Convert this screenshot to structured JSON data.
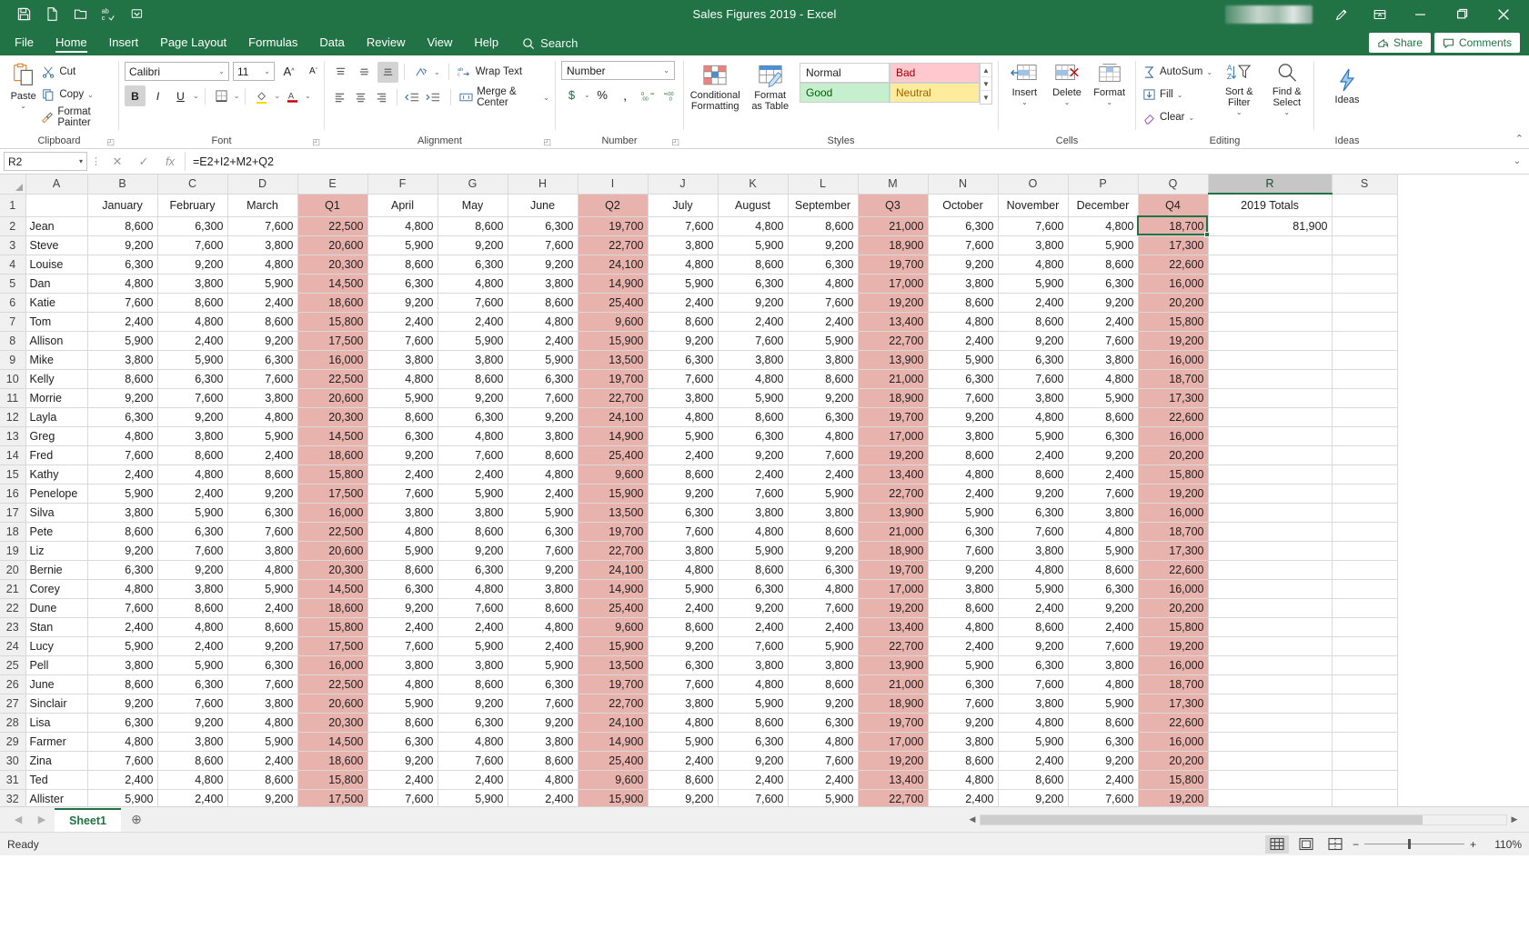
{
  "window": {
    "title": "Sales Figures 2019  -  Excel",
    "quick_access": [
      "save-icon",
      "new-icon",
      "open-icon",
      "spelling-icon",
      "customize-qat-icon"
    ],
    "controls": [
      "pen-icon",
      "ribbon-display-icon",
      "minimize-icon",
      "restore-icon",
      "close-icon"
    ]
  },
  "tabs": {
    "items": [
      "File",
      "Home",
      "Insert",
      "Page Layout",
      "Formulas",
      "Data",
      "Review",
      "View",
      "Help"
    ],
    "active": "Home",
    "search_placeholder": "Search",
    "share_label": "Share",
    "comments_label": "Comments"
  },
  "ribbon": {
    "clipboard": {
      "label": "Clipboard",
      "paste": "Paste",
      "cut": "Cut",
      "copy": "Copy",
      "format_painter": "Format Painter"
    },
    "font": {
      "label": "Font",
      "font_name": "Calibri",
      "font_size": "11",
      "grow_label": "A",
      "shrink_label": "A",
      "bold": "B",
      "italic": "I",
      "underline": "U"
    },
    "alignment": {
      "label": "Alignment",
      "wrap_text": "Wrap Text",
      "merge_center": "Merge & Center"
    },
    "number": {
      "label": "Number",
      "format": "Number",
      "currency": "$",
      "percent": "%",
      "comma": ","
    },
    "styles": {
      "label": "Styles",
      "conditional_formatting": "Conditional Formatting",
      "format_as_table": "Format as Table",
      "cell_styles": [
        "Normal",
        "Bad",
        "Good",
        "Neutral"
      ]
    },
    "cells": {
      "label": "Cells",
      "insert": "Insert",
      "delete": "Delete",
      "format": "Format"
    },
    "editing": {
      "label": "Editing",
      "autosum": "AutoSum",
      "fill": "Fill",
      "clear": "Clear",
      "sort_filter": "Sort & Filter",
      "find_select": "Find & Select"
    },
    "ideas": {
      "label": "Ideas",
      "button": "Ideas"
    }
  },
  "formula_bar": {
    "name_box": "R2",
    "formula": "=E2+I2+M2+Q2",
    "cancel_icon": "cancel-icon",
    "enter_icon": "enter-icon",
    "function_icon": "insert-function-icon"
  },
  "sheet": {
    "column_letters": [
      "A",
      "B",
      "C",
      "D",
      "E",
      "F",
      "G",
      "H",
      "I",
      "J",
      "K",
      "L",
      "M",
      "N",
      "O",
      "P",
      "Q",
      "R",
      "S"
    ],
    "selected_column": "R",
    "selected_cell": "R2",
    "headers": [
      "",
      "January",
      "February",
      "March",
      "Q1",
      "April",
      "May",
      "June",
      "Q2",
      "July",
      "August",
      "September",
      "Q3",
      "October",
      "November",
      "December",
      "Q4",
      "2019 Totals"
    ],
    "quarter_columns": [
      "Q1",
      "Q2",
      "Q3",
      "Q4"
    ],
    "total_column": "2019 Totals",
    "selected_value": "81,900",
    "rows": [
      {
        "n": 2,
        "name": "Jean",
        "v": [
          "8,600",
          "6,300",
          "7,600",
          "22,500",
          "4,800",
          "8,600",
          "6,300",
          "19,700",
          "7,600",
          "4,800",
          "8,600",
          "21,000",
          "6,300",
          "7,600",
          "4,800",
          "18,700"
        ],
        "total": "81,900"
      },
      {
        "n": 3,
        "name": "Steve",
        "v": [
          "9,200",
          "7,600",
          "3,800",
          "20,600",
          "5,900",
          "9,200",
          "7,600",
          "22,700",
          "3,800",
          "5,900",
          "9,200",
          "18,900",
          "7,600",
          "3,800",
          "5,900",
          "17,300"
        ],
        "total": ""
      },
      {
        "n": 4,
        "name": "Louise",
        "v": [
          "6,300",
          "9,200",
          "4,800",
          "20,300",
          "8,600",
          "6,300",
          "9,200",
          "24,100",
          "4,800",
          "8,600",
          "6,300",
          "19,700",
          "9,200",
          "4,800",
          "8,600",
          "22,600"
        ],
        "total": ""
      },
      {
        "n": 5,
        "name": "Dan",
        "v": [
          "4,800",
          "3,800",
          "5,900",
          "14,500",
          "6,300",
          "4,800",
          "3,800",
          "14,900",
          "5,900",
          "6,300",
          "4,800",
          "17,000",
          "3,800",
          "5,900",
          "6,300",
          "16,000"
        ],
        "total": ""
      },
      {
        "n": 6,
        "name": "Katie",
        "v": [
          "7,600",
          "8,600",
          "2,400",
          "18,600",
          "9,200",
          "7,600",
          "8,600",
          "25,400",
          "2,400",
          "9,200",
          "7,600",
          "19,200",
          "8,600",
          "2,400",
          "9,200",
          "20,200"
        ],
        "total": ""
      },
      {
        "n": 7,
        "name": "Tom",
        "v": [
          "2,400",
          "4,800",
          "8,600",
          "15,800",
          "2,400",
          "2,400",
          "4,800",
          "9,600",
          "8,600",
          "2,400",
          "2,400",
          "13,400",
          "4,800",
          "8,600",
          "2,400",
          "15,800"
        ],
        "total": ""
      },
      {
        "n": 8,
        "name": "Allison",
        "v": [
          "5,900",
          "2,400",
          "9,200",
          "17,500",
          "7,600",
          "5,900",
          "2,400",
          "15,900",
          "9,200",
          "7,600",
          "5,900",
          "22,700",
          "2,400",
          "9,200",
          "7,600",
          "19,200"
        ],
        "total": ""
      },
      {
        "n": 9,
        "name": "Mike",
        "v": [
          "3,800",
          "5,900",
          "6,300",
          "16,000",
          "3,800",
          "3,800",
          "5,900",
          "13,500",
          "6,300",
          "3,800",
          "3,800",
          "13,900",
          "5,900",
          "6,300",
          "3,800",
          "16,000"
        ],
        "total": ""
      },
      {
        "n": 10,
        "name": "Kelly",
        "v": [
          "8,600",
          "6,300",
          "7,600",
          "22,500",
          "4,800",
          "8,600",
          "6,300",
          "19,700",
          "7,600",
          "4,800",
          "8,600",
          "21,000",
          "6,300",
          "7,600",
          "4,800",
          "18,700"
        ],
        "total": ""
      },
      {
        "n": 11,
        "name": "Morrie",
        "v": [
          "9,200",
          "7,600",
          "3,800",
          "20,600",
          "5,900",
          "9,200",
          "7,600",
          "22,700",
          "3,800",
          "5,900",
          "9,200",
          "18,900",
          "7,600",
          "3,800",
          "5,900",
          "17,300"
        ],
        "total": ""
      },
      {
        "n": 12,
        "name": "Layla",
        "v": [
          "6,300",
          "9,200",
          "4,800",
          "20,300",
          "8,600",
          "6,300",
          "9,200",
          "24,100",
          "4,800",
          "8,600",
          "6,300",
          "19,700",
          "9,200",
          "4,800",
          "8,600",
          "22,600"
        ],
        "total": ""
      },
      {
        "n": 13,
        "name": "Greg",
        "v": [
          "4,800",
          "3,800",
          "5,900",
          "14,500",
          "6,300",
          "4,800",
          "3,800",
          "14,900",
          "5,900",
          "6,300",
          "4,800",
          "17,000",
          "3,800",
          "5,900",
          "6,300",
          "16,000"
        ],
        "total": ""
      },
      {
        "n": 14,
        "name": "Fred",
        "v": [
          "7,600",
          "8,600",
          "2,400",
          "18,600",
          "9,200",
          "7,600",
          "8,600",
          "25,400",
          "2,400",
          "9,200",
          "7,600",
          "19,200",
          "8,600",
          "2,400",
          "9,200",
          "20,200"
        ],
        "total": ""
      },
      {
        "n": 15,
        "name": "Kathy",
        "v": [
          "2,400",
          "4,800",
          "8,600",
          "15,800",
          "2,400",
          "2,400",
          "4,800",
          "9,600",
          "8,600",
          "2,400",
          "2,400",
          "13,400",
          "4,800",
          "8,600",
          "2,400",
          "15,800"
        ],
        "total": ""
      },
      {
        "n": 16,
        "name": "Penelope",
        "v": [
          "5,900",
          "2,400",
          "9,200",
          "17,500",
          "7,600",
          "5,900",
          "2,400",
          "15,900",
          "9,200",
          "7,600",
          "5,900",
          "22,700",
          "2,400",
          "9,200",
          "7,600",
          "19,200"
        ],
        "total": ""
      },
      {
        "n": 17,
        "name": "Silva",
        "v": [
          "3,800",
          "5,900",
          "6,300",
          "16,000",
          "3,800",
          "3,800",
          "5,900",
          "13,500",
          "6,300",
          "3,800",
          "3,800",
          "13,900",
          "5,900",
          "6,300",
          "3,800",
          "16,000"
        ],
        "total": ""
      },
      {
        "n": 18,
        "name": "Pete",
        "v": [
          "8,600",
          "6,300",
          "7,600",
          "22,500",
          "4,800",
          "8,600",
          "6,300",
          "19,700",
          "7,600",
          "4,800",
          "8,600",
          "21,000",
          "6,300",
          "7,600",
          "4,800",
          "18,700"
        ],
        "total": ""
      },
      {
        "n": 19,
        "name": "Liz",
        "v": [
          "9,200",
          "7,600",
          "3,800",
          "20,600",
          "5,900",
          "9,200",
          "7,600",
          "22,700",
          "3,800",
          "5,900",
          "9,200",
          "18,900",
          "7,600",
          "3,800",
          "5,900",
          "17,300"
        ],
        "total": ""
      },
      {
        "n": 20,
        "name": "Bernie",
        "v": [
          "6,300",
          "9,200",
          "4,800",
          "20,300",
          "8,600",
          "6,300",
          "9,200",
          "24,100",
          "4,800",
          "8,600",
          "6,300",
          "19,700",
          "9,200",
          "4,800",
          "8,600",
          "22,600"
        ],
        "total": ""
      },
      {
        "n": 21,
        "name": "Corey",
        "v": [
          "4,800",
          "3,800",
          "5,900",
          "14,500",
          "6,300",
          "4,800",
          "3,800",
          "14,900",
          "5,900",
          "6,300",
          "4,800",
          "17,000",
          "3,800",
          "5,900",
          "6,300",
          "16,000"
        ],
        "total": ""
      },
      {
        "n": 22,
        "name": "Dune",
        "v": [
          "7,600",
          "8,600",
          "2,400",
          "18,600",
          "9,200",
          "7,600",
          "8,600",
          "25,400",
          "2,400",
          "9,200",
          "7,600",
          "19,200",
          "8,600",
          "2,400",
          "9,200",
          "20,200"
        ],
        "total": ""
      },
      {
        "n": 23,
        "name": "Stan",
        "v": [
          "2,400",
          "4,800",
          "8,600",
          "15,800",
          "2,400",
          "2,400",
          "4,800",
          "9,600",
          "8,600",
          "2,400",
          "2,400",
          "13,400",
          "4,800",
          "8,600",
          "2,400",
          "15,800"
        ],
        "total": ""
      },
      {
        "n": 24,
        "name": "Lucy",
        "v": [
          "5,900",
          "2,400",
          "9,200",
          "17,500",
          "7,600",
          "5,900",
          "2,400",
          "15,900",
          "9,200",
          "7,600",
          "5,900",
          "22,700",
          "2,400",
          "9,200",
          "7,600",
          "19,200"
        ],
        "total": ""
      },
      {
        "n": 25,
        "name": "Pell",
        "v": [
          "3,800",
          "5,900",
          "6,300",
          "16,000",
          "3,800",
          "3,800",
          "5,900",
          "13,500",
          "6,300",
          "3,800",
          "3,800",
          "13,900",
          "5,900",
          "6,300",
          "3,800",
          "16,000"
        ],
        "total": ""
      },
      {
        "n": 26,
        "name": "June",
        "v": [
          "8,600",
          "6,300",
          "7,600",
          "22,500",
          "4,800",
          "8,600",
          "6,300",
          "19,700",
          "7,600",
          "4,800",
          "8,600",
          "21,000",
          "6,300",
          "7,600",
          "4,800",
          "18,700"
        ],
        "total": ""
      },
      {
        "n": 27,
        "name": "Sinclair",
        "v": [
          "9,200",
          "7,600",
          "3,800",
          "20,600",
          "5,900",
          "9,200",
          "7,600",
          "22,700",
          "3,800",
          "5,900",
          "9,200",
          "18,900",
          "7,600",
          "3,800",
          "5,900",
          "17,300"
        ],
        "total": ""
      },
      {
        "n": 28,
        "name": "Lisa",
        "v": [
          "6,300",
          "9,200",
          "4,800",
          "20,300",
          "8,600",
          "6,300",
          "9,200",
          "24,100",
          "4,800",
          "8,600",
          "6,300",
          "19,700",
          "9,200",
          "4,800",
          "8,600",
          "22,600"
        ],
        "total": ""
      },
      {
        "n": 29,
        "name": "Farmer",
        "v": [
          "4,800",
          "3,800",
          "5,900",
          "14,500",
          "6,300",
          "4,800",
          "3,800",
          "14,900",
          "5,900",
          "6,300",
          "4,800",
          "17,000",
          "3,800",
          "5,900",
          "6,300",
          "16,000"
        ],
        "total": ""
      },
      {
        "n": 30,
        "name": "Zina",
        "v": [
          "7,600",
          "8,600",
          "2,400",
          "18,600",
          "9,200",
          "7,600",
          "8,600",
          "25,400",
          "2,400",
          "9,200",
          "7,600",
          "19,200",
          "8,600",
          "2,400",
          "9,200",
          "20,200"
        ],
        "total": ""
      },
      {
        "n": 31,
        "name": "Ted",
        "v": [
          "2,400",
          "4,800",
          "8,600",
          "15,800",
          "2,400",
          "2,400",
          "4,800",
          "9,600",
          "8,600",
          "2,400",
          "2,400",
          "13,400",
          "4,800",
          "8,600",
          "2,400",
          "15,800"
        ],
        "total": ""
      },
      {
        "n": 32,
        "name": "Allister",
        "v": [
          "5,900",
          "2,400",
          "9,200",
          "17,500",
          "7,600",
          "5,900",
          "2,400",
          "15,900",
          "9,200",
          "7,600",
          "5,900",
          "22,700",
          "2,400",
          "9,200",
          "7,600",
          "19,200"
        ],
        "total": ""
      }
    ]
  },
  "sheet_tabs": {
    "tabs": [
      "Sheet1"
    ],
    "active": "Sheet1",
    "add_label": "+"
  },
  "status_bar": {
    "state": "Ready",
    "views": [
      "normal-view-icon",
      "page-layout-view-icon",
      "page-break-preview-icon"
    ],
    "active_view": "normal-view-icon",
    "zoom_out": "−",
    "zoom_in": "+",
    "zoom_level": "110%"
  },
  "colors": {
    "brand_green": "#217346",
    "quarter_fill": "#e8b2ad",
    "bad": "#ffc7ce",
    "good": "#c6efce",
    "neutral": "#ffeb9c"
  }
}
